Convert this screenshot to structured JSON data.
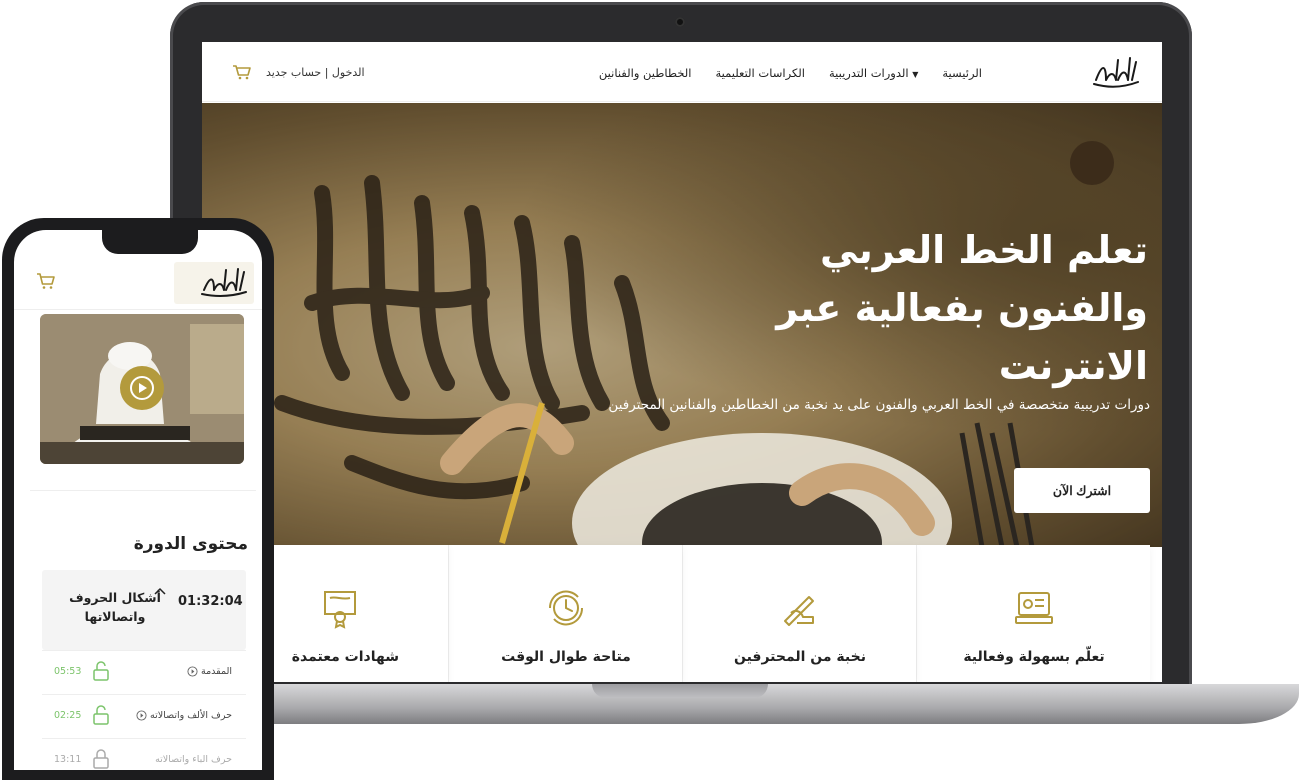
{
  "colors": {
    "gold": "#b39a3c",
    "green": "#7cc46b",
    "text": "#222222"
  },
  "laptop": {
    "nav": {
      "auth": "الدخول | حساب جديد",
      "menu": [
        "الرئيسية",
        "الدورات التدريبية",
        "الكراسات التعليمية",
        "الخطاطين والفنانين"
      ],
      "logo_icon": "calligraphy-logo-icon",
      "cart_icon": "cart-icon"
    },
    "hero": {
      "title_line1": "تعلم الخط العربي",
      "title_line2": "والفنون بفعالية عبر",
      "title_line3": "الانترنت",
      "subtitle": "دورات تدريبية متخصصة في الخط العربي والفنون على يد نخبة من الخطاطين والفنانين المحترفين",
      "cta": "اشترك الآن"
    },
    "features": [
      {
        "title": "تعلّم بسهولة وفعالية",
        "icon": "online-learning-icon"
      },
      {
        "title": "نخبة من المحترفين",
        "icon": "pen-hand-icon"
      },
      {
        "title": "متاحة طوال الوقت",
        "icon": "clock-icon"
      },
      {
        "title": "شهادات معتمدة",
        "icon": "certificate-icon"
      }
    ]
  },
  "phone": {
    "course_content_title": "محتوى الدورة",
    "section": {
      "name": "أشكال الحروف واتصالاتها",
      "duration": "01:32:04"
    },
    "lessons": [
      {
        "name": "المقدمة",
        "duration": "05:53",
        "locked": false
      },
      {
        "name": "حرف الألف واتصالاته",
        "duration": "02:25",
        "locked": false
      },
      {
        "name": "حرف الباء واتصالاته",
        "duration": "13:11",
        "locked": true
      }
    ]
  }
}
